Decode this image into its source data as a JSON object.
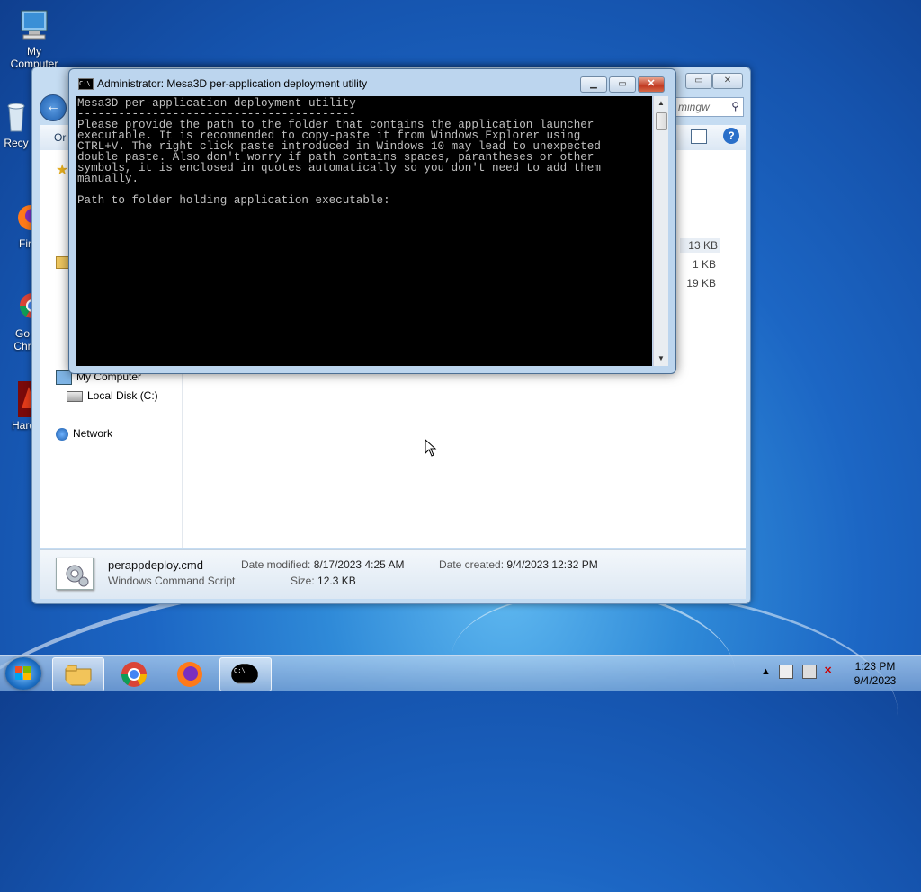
{
  "desktop": {
    "icons": [
      {
        "label": "My Computer"
      },
      {
        "label": "Recy"
      },
      {
        "label": "Fir"
      },
      {
        "label": "Go Chr"
      },
      {
        "label": "Hard"
      }
    ]
  },
  "explorer": {
    "search_placeholder": "mingw",
    "organize_label": "Or",
    "nav": {
      "my_computer": "My Computer",
      "local_disk": "Local Disk (C:)",
      "network": "Network"
    },
    "file_sizes": [
      "13 KB",
      "1 KB",
      "19 KB"
    ],
    "details": {
      "file_name": "perappdeploy.cmd",
      "file_type": "Windows Command Script",
      "date_modified_label": "Date modified:",
      "date_modified": "8/17/2023 4:25 AM",
      "size_label": "Size:",
      "size": "12.3 KB",
      "date_created_label": "Date created:",
      "date_created": "9/4/2023 12:32 PM"
    }
  },
  "console": {
    "title": "Administrator:  Mesa3D per-application deployment utility",
    "text": "Mesa3D per-application deployment utility\n-----------------------------------------\nPlease provide the path to the folder that contains the application launcher\nexecutable. It is recommended to copy-paste it from Windows Explorer using\nCTRL+V. The right click paste introduced in Windows 10 may lead to unexpected\ndouble paste. Also don't worry if path contains spaces, parantheses or other\nsymbols, it is enclosed in quotes automatically so you don't need to add them\nmanually.\n\nPath to folder holding application executable:"
  },
  "taskbar": {
    "apps": [
      "windows-explorer-icon",
      "chrome-icon",
      "firefox-icon",
      "command-prompt-icon"
    ],
    "active_app": "command-prompt-icon",
    "time": "1:23 PM",
    "date": "9/4/2023"
  },
  "colors": {
    "console_bg": "#000000",
    "console_fg": "#c0c0c0",
    "close_button": "#c23b22"
  }
}
